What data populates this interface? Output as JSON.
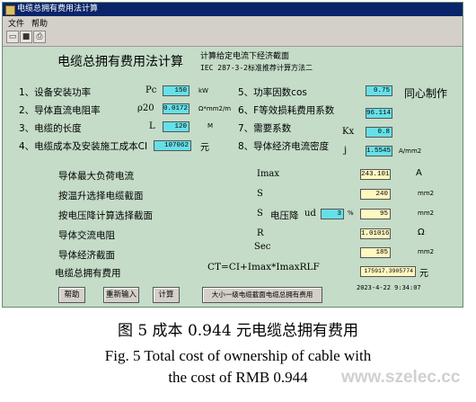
{
  "window": {
    "title": "电缆总拥有费用法计算"
  },
  "menu": [
    "文件",
    "帮助"
  ],
  "header": {
    "title": "电缆总拥有费用法计算",
    "subtitle": "计算给定电流下经济截面",
    "standard": "IEC 287-3-2标准推荐计算方法二",
    "brand": "同心制作"
  },
  "params": {
    "p1": {
      "label": "1、设备安装功率",
      "symbol": "Pc",
      "value": "150",
      "unit": "kW"
    },
    "p2": {
      "label": "2、导体直流电阻率",
      "symbol": "ρ20",
      "value": "0.0172",
      "unit": "Ω*mm2/m"
    },
    "p3": {
      "label": "3、电缆的长度",
      "symbol": "L",
      "value": "120",
      "unit": "M"
    },
    "p4": {
      "label": "4、电缆成本及安装施工成本CI",
      "value": "107062",
      "unit": "元"
    },
    "p5": {
      "label": "5、功率因数cos",
      "value": "0.75"
    },
    "p6": {
      "label": "6、F等效损耗费用系数",
      "value": "96.114"
    },
    "p7": {
      "label": "7、需要系数",
      "symbol": "Kx",
      "value": "0.8"
    },
    "p8": {
      "label": "8、导体经济电流密度",
      "symbol": "j",
      "value": "1.5545",
      "unit": "A/mm2"
    }
  },
  "results": {
    "r1": {
      "label": "导体最大负荷电流",
      "symbol": "Imax",
      "value": "243.101",
      "unit": "A"
    },
    "r2": {
      "label": "按温升选择电缆截面",
      "symbol": "S",
      "value": "240",
      "unit": "mm2"
    },
    "r3": {
      "label": "按电压降计算选择截面",
      "symbol": "S",
      "vdrop_label": "电压降",
      "vdrop_symbol": "ud",
      "vdrop_value": "3",
      "vdrop_unit": "%",
      "value": "95",
      "unit": "mm2"
    },
    "r4": {
      "label": "导体交流电阻",
      "symbol": "R",
      "value": "1.01016",
      "unit": "Ω"
    },
    "r5": {
      "label": "导体经济截面",
      "symbol": "Sec",
      "value": "185",
      "unit": "mm2"
    },
    "r6": {
      "label": "电缆总拥有费用",
      "formula": "CT=CI+Imax*ImaxRLF",
      "value": "175917.3905774",
      "unit": "元"
    }
  },
  "buttons": {
    "help": "帮助",
    "reset": "重新输入",
    "calc": "计算",
    "lower": "大小一级电缆截面电缆总拥有费用"
  },
  "timestamp": "2023-4-22 9:34:07",
  "caption": {
    "cn": "图 5   成本 0.944 元电缆总拥有费用",
    "en1": "Fig. 5   Total cost of ownership of cable with",
    "en2": "the cost of RMB 0.944"
  },
  "watermark": "www.szelec.cc"
}
